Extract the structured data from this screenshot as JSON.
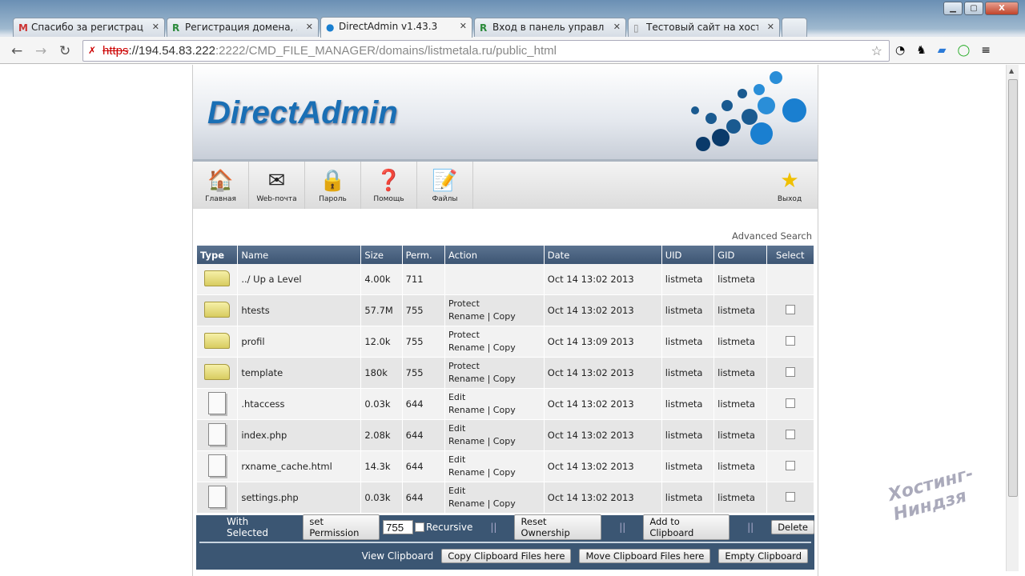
{
  "browser": {
    "tabs": [
      {
        "icon": "M",
        "title": "Спасибо за регистрацию"
      },
      {
        "icon": "R",
        "title": "Регистрация домена, Хо"
      },
      {
        "icon": "●",
        "title": "DirectAdmin v1.43.3"
      },
      {
        "icon": "R",
        "title": "Вход в панель управлени"
      },
      {
        "icon": "▯",
        "title": "Тестовый сайт на хостин"
      }
    ],
    "url": {
      "scheme": "https",
      "host": "://194.54.83.222",
      "port": ":2222",
      "path": "/CMD_FILE_MANAGER/domains/listmetala.ru/public_html"
    }
  },
  "header": {
    "logo": "DirectAdmin"
  },
  "menu": [
    {
      "icon": "🏠",
      "label": "Главная"
    },
    {
      "icon": "✉",
      "label": "Web-почта"
    },
    {
      "icon": "🔒",
      "label": "Пароль"
    },
    {
      "icon": "❓",
      "label": "Помощь"
    },
    {
      "icon": "📝",
      "label": "Файлы"
    }
  ],
  "exit": {
    "icon": "★",
    "label": "Выход"
  },
  "advanced_search": "Advanced Search",
  "table": {
    "headers": [
      "Type",
      "Name",
      "Size",
      "Perm.",
      "Action",
      "Date",
      "UID",
      "GID",
      "Select"
    ],
    "rows": [
      {
        "type": "folder",
        "name": "../ Up a Level",
        "size": "4.00k",
        "perm": "711",
        "a1": "",
        "a2": "",
        "date": "Oct 14 13:02 2013",
        "uid": "listmeta",
        "gid": "listmeta",
        "select": false
      },
      {
        "type": "folder",
        "name": "htests",
        "size": "57.7M",
        "perm": "755",
        "a1": "Protect",
        "a2": "Rename | Copy",
        "date": "Oct 14 13:02 2013",
        "uid": "listmeta",
        "gid": "listmeta",
        "select": true
      },
      {
        "type": "folder",
        "name": "profil",
        "size": "12.0k",
        "perm": "755",
        "a1": "Protect",
        "a2": "Rename | Copy",
        "date": "Oct 14 13:09 2013",
        "uid": "listmeta",
        "gid": "listmeta",
        "select": true
      },
      {
        "type": "folder",
        "name": "template",
        "size": "180k",
        "perm": "755",
        "a1": "Protect",
        "a2": "Rename | Copy",
        "date": "Oct 14 13:02 2013",
        "uid": "listmeta",
        "gid": "listmeta",
        "select": true
      },
      {
        "type": "file",
        "name": ".htaccess",
        "size": "0.03k",
        "perm": "644",
        "a1": "Edit",
        "a2": "Rename | Copy",
        "date": "Oct 14 13:02 2013",
        "uid": "listmeta",
        "gid": "listmeta",
        "select": true
      },
      {
        "type": "file",
        "name": "index.php",
        "size": "2.08k",
        "perm": "644",
        "a1": "Edit",
        "a2": "Rename | Copy",
        "date": "Oct 14 13:02 2013",
        "uid": "listmeta",
        "gid": "listmeta",
        "select": true
      },
      {
        "type": "file",
        "name": "rxname_cache.html",
        "size": "14.3k",
        "perm": "644",
        "a1": "Edit",
        "a2": "Rename | Copy",
        "date": "Oct 14 13:02 2013",
        "uid": "listmeta",
        "gid": "listmeta",
        "select": true
      },
      {
        "type": "file",
        "name": "settings.php",
        "size": "0.03k",
        "perm": "644",
        "a1": "Edit",
        "a2": "Rename | Copy",
        "date": "Oct 14 13:02 2013",
        "uid": "listmeta",
        "gid": "listmeta",
        "select": true
      }
    ]
  },
  "actions": {
    "with_selected": "With Selected",
    "set_permission": "set Permission",
    "perm_value": "755",
    "recursive": "Recursive",
    "sep": "||",
    "reset_ownership": "Reset Ownership",
    "add_clipboard": "Add to Clipboard",
    "delete": "Delete",
    "view_clipboard": "View Clipboard",
    "copy_here": "Copy Clipboard Files here",
    "move_here": "Move Clipboard Files here",
    "empty": "Empty Clipboard"
  },
  "watermark": "Хостинг-Ниндзя"
}
